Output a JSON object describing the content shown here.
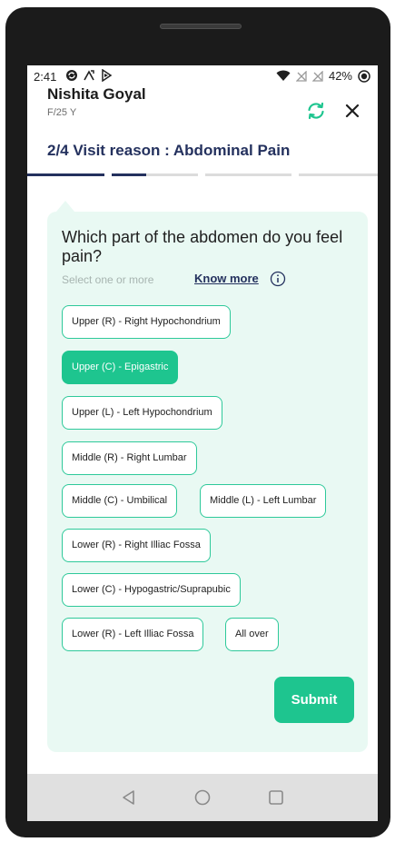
{
  "status_bar": {
    "time": "2:41",
    "battery": "42%",
    "icons": [
      "sync-status-icon",
      "signal-wave-icon",
      "media-icon",
      "wifi-icon",
      "no-signal-icon",
      "no-signal-icon",
      "battery-icon"
    ]
  },
  "header": {
    "patient_name": "Nishita Goyal",
    "patient_meta": "F/25 Y",
    "refresh_icon": "refresh-icon",
    "close_icon": "close-icon"
  },
  "visit": {
    "title": "2/4 Visit reason : Abdominal Pain",
    "step": 2,
    "total_steps": 4
  },
  "question": {
    "text": "Which part of the abdomen do you feel pain?",
    "hint": "Select one or more",
    "know_more": "Know more",
    "info_icon": "info-icon"
  },
  "options": [
    {
      "label": "Upper (R) - Right Hypochondrium",
      "selected": false
    },
    {
      "label": "Upper (C) - Epigastric",
      "selected": true
    },
    {
      "label": "Upper (L) - Left Hypochondrium",
      "selected": false
    },
    {
      "label": "Middle (R) - Right Lumbar",
      "selected": false
    },
    {
      "label": "Middle (C) - Umbilical",
      "selected": false
    },
    {
      "label": "Middle (L) - Left Lumbar",
      "selected": false
    },
    {
      "label": "Lower (R) - Right Illiac Fossa",
      "selected": false
    },
    {
      "label": "Lower (C) - Hypogastric/Suprapubic",
      "selected": false
    },
    {
      "label": "Lower (R) - Left Illiac Fossa",
      "selected": false
    },
    {
      "label": "All over",
      "selected": false
    }
  ],
  "submit_label": "Submit",
  "colors": {
    "accent": "#1ec58f",
    "card_bg": "#e9f9f3",
    "title": "#24315e",
    "progress_active": "#24315e",
    "progress_inactive": "#dcdcdc"
  }
}
